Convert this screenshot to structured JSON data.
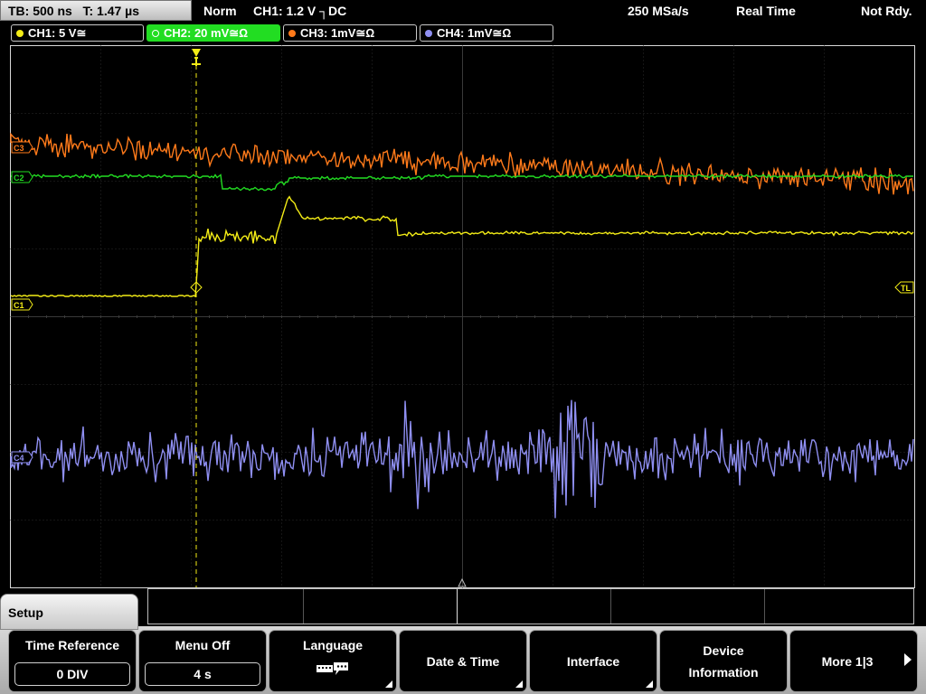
{
  "status": {
    "timebase": "TB: 500 ns",
    "trigger_time": "T: 1.47 µs",
    "mode": "Norm",
    "trigger": "CH1: 1.2 V ┐DC",
    "sample_rate": "250 MSa/s",
    "acq_mode": "Real Time",
    "state": "Not Rdy."
  },
  "channels": [
    {
      "label": "CH1: 5 V≅",
      "color": "#f3ec16"
    },
    {
      "label": "CH2: 20 mV≅Ω",
      "color": "#22dd22"
    },
    {
      "label": "CH3: 1mV≅Ω",
      "color": "#ff7a1a"
    },
    {
      "label": "CH4: 1mV≅Ω",
      "color": "#8f8ff2"
    }
  ],
  "markers": {
    "c3": "C3",
    "c2": "C2",
    "c1": "C1",
    "c4": "C4",
    "trigger_level": "TL"
  },
  "menu": {
    "title": "Setup",
    "time_reference": {
      "label": "Time Reference",
      "value": "0 DIV"
    },
    "menu_off": {
      "label": "Menu Off",
      "value": "4 s"
    },
    "language": {
      "label": "Language"
    },
    "date_time": {
      "label": "Date & Time"
    },
    "interface": {
      "label": "Interface"
    },
    "device_info": {
      "line1": "Device",
      "line2": "Information"
    },
    "more": {
      "label": "More 1|3"
    }
  },
  "icons": {
    "keyboard": "keyboard-speech-icon",
    "more_arrow": "arrow-right-icon",
    "submenu": "submenu-corner-icon"
  }
}
